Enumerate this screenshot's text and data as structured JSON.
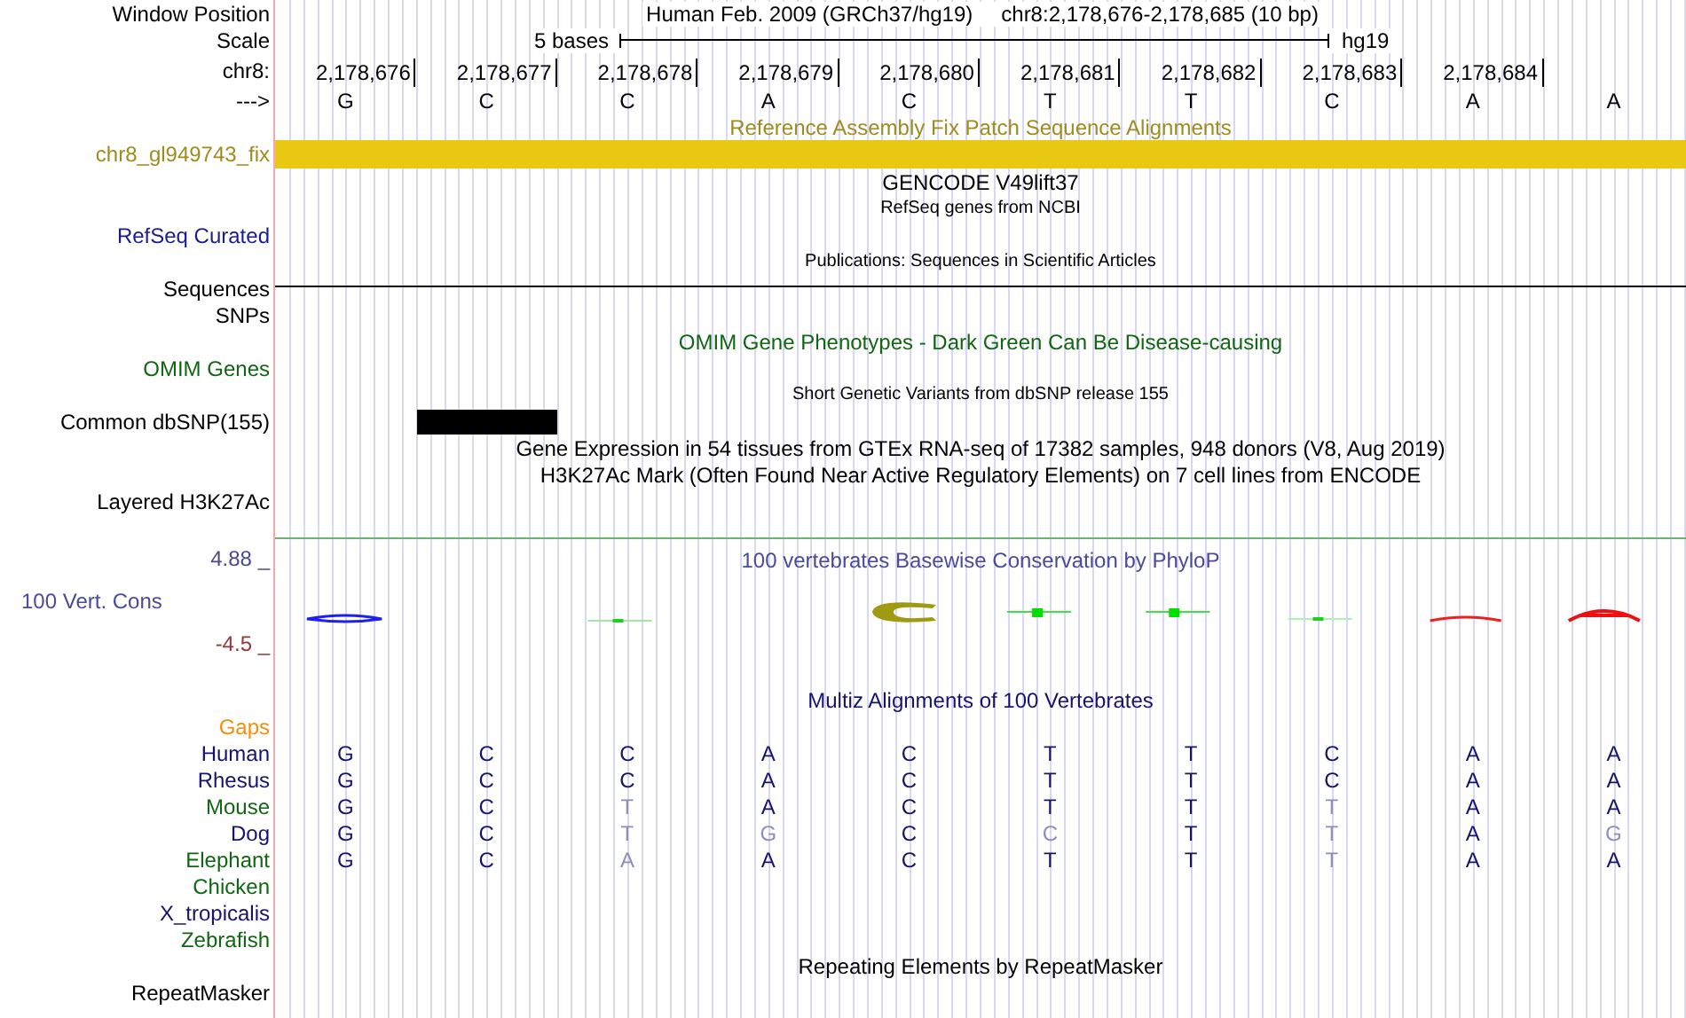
{
  "header": {
    "label": "Window Position",
    "title": "Human Feb. 2009 (GRCh37/hg19)",
    "position": "chr8:2,178,676-2,178,685 (10 bp)"
  },
  "scale": {
    "label": "Scale",
    "text": "5 bases",
    "assembly": "hg19"
  },
  "coordinates": {
    "label": "chr8:",
    "positions": [
      "2,178,676",
      "2,178,677",
      "2,178,678",
      "2,178,679",
      "2,178,680",
      "2,178,681",
      "2,178,682",
      "2,178,683",
      "2,178,684"
    ]
  },
  "strand": {
    "label": "--->",
    "bases": [
      "G",
      "C",
      "C",
      "A",
      "C",
      "T",
      "T",
      "C",
      "A",
      "A"
    ]
  },
  "rows": [
    {
      "kind": "title",
      "title": "Reference Assembly Fix Patch Sequence Alignments",
      "color": "#a08c1e"
    },
    {
      "kind": "bar",
      "label": "chr8_gl949743_fix",
      "color": "#a08c1e"
    },
    {
      "kind": "title",
      "title": "GENCODE V49lift37",
      "color": "#000000"
    },
    {
      "kind": "small",
      "title": "RefSeq genes from NCBI",
      "color": "#000000"
    },
    {
      "kind": "label",
      "label": "RefSeq Curated",
      "color": "#1c1c8c"
    },
    {
      "kind": "small",
      "title": "Publications: Sequences in Scientific Articles",
      "color": "#000000"
    },
    {
      "kind": "line",
      "label": "Sequences",
      "color": "#000000"
    },
    {
      "kind": "label",
      "label": "SNPs",
      "color": "#000000"
    },
    {
      "kind": "title",
      "title": "OMIM Gene Phenotypes - Dark Green Can Be Disease-causing",
      "color": "#116611"
    },
    {
      "kind": "label",
      "label": "OMIM Genes",
      "color": "#116611"
    },
    {
      "kind": "small",
      "title": "Short Genetic Variants from dbSNP release 155",
      "color": "#000000"
    },
    {
      "kind": "snp",
      "label": "Common dbSNP(155)",
      "color": "#000000"
    },
    {
      "kind": "title",
      "title": "Gene Expression in 54 tissues from GTEx RNA-seq of 17382 samples, 948 donors (V8, Aug 2019)",
      "color": "#000000"
    },
    {
      "kind": "title",
      "title": "H3K27Ac Mark (Often Found Near Active Regulatory Elements) on 7 cell lines from ENCODE",
      "color": "#000000"
    },
    {
      "kind": "label",
      "label": "Layered H3K27Ac",
      "color": "#000000"
    }
  ],
  "conservation": {
    "max": "4.88 _",
    "label": "100 Vert. Cons",
    "min": "-4.5 _",
    "title": "100 vertebrates Basewise Conservation by PhyloP"
  },
  "alignment": {
    "title": "Multiz Alignments of 100 Vertebrates",
    "gaps_label": "Gaps",
    "species": [
      {
        "name": "Human",
        "color": "#14146e",
        "bases": [
          {
            "b": "G",
            "match": true
          },
          {
            "b": "C",
            "match": true
          },
          {
            "b": "C",
            "match": true
          },
          {
            "b": "A",
            "match": true
          },
          {
            "b": "C",
            "match": true
          },
          {
            "b": "T",
            "match": true
          },
          {
            "b": "T",
            "match": true
          },
          {
            "b": "C",
            "match": true
          },
          {
            "b": "A",
            "match": true
          },
          {
            "b": "A",
            "match": true
          }
        ]
      },
      {
        "name": "Rhesus",
        "color": "#14146e",
        "bases": [
          {
            "b": "G",
            "match": true
          },
          {
            "b": "C",
            "match": true
          },
          {
            "b": "C",
            "match": true
          },
          {
            "b": "A",
            "match": true
          },
          {
            "b": "C",
            "match": true
          },
          {
            "b": "T",
            "match": true
          },
          {
            "b": "T",
            "match": true
          },
          {
            "b": "C",
            "match": true
          },
          {
            "b": "A",
            "match": true
          },
          {
            "b": "A",
            "match": true
          }
        ]
      },
      {
        "name": "Mouse",
        "color": "#116611",
        "bases": [
          {
            "b": "G",
            "match": true
          },
          {
            "b": "C",
            "match": true
          },
          {
            "b": "T",
            "match": false
          },
          {
            "b": "A",
            "match": true
          },
          {
            "b": "C",
            "match": true
          },
          {
            "b": "T",
            "match": true
          },
          {
            "b": "T",
            "match": true
          },
          {
            "b": "T",
            "match": false
          },
          {
            "b": "A",
            "match": true
          },
          {
            "b": "A",
            "match": true
          }
        ]
      },
      {
        "name": "Dog",
        "color": "#14146e",
        "bases": [
          {
            "b": "G",
            "match": true
          },
          {
            "b": "C",
            "match": true
          },
          {
            "b": "T",
            "match": false
          },
          {
            "b": "G",
            "match": false
          },
          {
            "b": "C",
            "match": true
          },
          {
            "b": "C",
            "match": false
          },
          {
            "b": "T",
            "match": true
          },
          {
            "b": "T",
            "match": false
          },
          {
            "b": "A",
            "match": true
          },
          {
            "b": "G",
            "match": false
          }
        ]
      },
      {
        "name": "Elephant",
        "color": "#116611",
        "bases": [
          {
            "b": "G",
            "match": true
          },
          {
            "b": "C",
            "match": true
          },
          {
            "b": "A",
            "match": false
          },
          {
            "b": "A",
            "match": true
          },
          {
            "b": "C",
            "match": true
          },
          {
            "b": "T",
            "match": true
          },
          {
            "b": "T",
            "match": true
          },
          {
            "b": "T",
            "match": false
          },
          {
            "b": "A",
            "match": true
          },
          {
            "b": "A",
            "match": true
          }
        ]
      },
      {
        "name": "Chicken",
        "color": "#116611"
      },
      {
        "name": "X_tropicalis",
        "color": "#14146e"
      },
      {
        "name": "Zebrafish",
        "color": "#116611"
      }
    ]
  },
  "repeats": {
    "title": "Repeating Elements by RepeatMasker",
    "label": "RepeatMasker"
  }
}
